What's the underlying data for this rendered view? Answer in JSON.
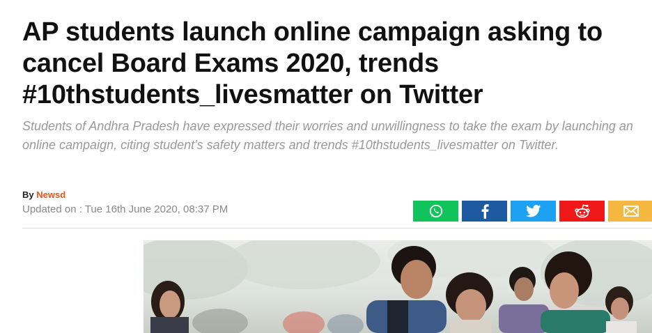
{
  "article": {
    "headline": "AP students launch online campaign asking to cancel Board Exams 2020, trends #10thstudents_livesmatter on Twitter",
    "summary": "Students of Andhra Pradesh have expressed their worries and unwillingness to take the exam by launching an online campaign, citing student's safety matters and trends #10thstudents_livesmatter on Twitter.",
    "byline_prefix": "By",
    "author": "Newsd",
    "updated": "Updated on : Tue 16th June 2020, 08:37 PM"
  },
  "share": [
    {
      "name": "whatsapp",
      "icon": "whatsapp-icon",
      "color": "#10c35b"
    },
    {
      "name": "facebook",
      "icon": "facebook-icon",
      "color": "#1e5aa0"
    },
    {
      "name": "twitter",
      "icon": "twitter-icon",
      "color": "#1da1f2"
    },
    {
      "name": "reddit",
      "icon": "reddit-icon",
      "color": "#f01818"
    },
    {
      "name": "email",
      "icon": "email-icon",
      "color": "#f5b73f"
    }
  ],
  "hero_image": {
    "subject": "students-outdoors-photo"
  }
}
